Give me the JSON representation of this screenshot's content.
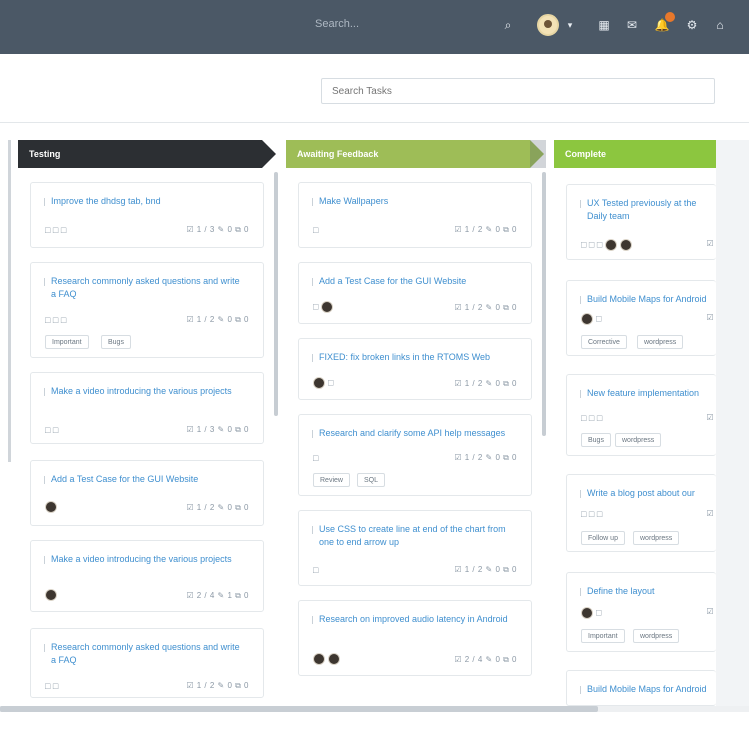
{
  "topbar": {
    "search_placeholder": "Search...",
    "icons": [
      "search-icon",
      "avatar",
      "caret-down-icon",
      "grid-icon",
      "chat-icon",
      "bell-icon",
      "gear-icon",
      "home-icon"
    ]
  },
  "toolbar": {
    "task_search_placeholder": "Search Tasks"
  },
  "colors": {
    "testing": "#2c2f33",
    "feedback": "#9ebd57",
    "complete": "#8cc63f",
    "link": "#3f8fcf",
    "topbar": "#4b5866"
  },
  "columns": [
    {
      "title": "Testing",
      "cards": [
        {
          "title": "Improve the dhdsg tab, bnd",
          "meta": "☑ 1 / 3  ✎ 0  ⧉ 0",
          "checks": "□ □ □",
          "tags": []
        },
        {
          "title": "Research commonly asked questions and write a FAQ",
          "meta": "☑ 1 / 2  ✎ 0  ⧉ 0",
          "checks": "□ □ □",
          "tags": [
            "Important",
            "Bugs"
          ]
        },
        {
          "title": "Make a video introducing the various projects",
          "meta": "☑ 1 / 3  ✎ 0  ⧉ 0",
          "checks": "□ □",
          "tags": []
        },
        {
          "title": "Add a Test Case for the GUI Website",
          "meta": "☑ 1 / 2  ✎ 0  ⧉ 0",
          "checks": "●",
          "tags": []
        },
        {
          "title": "Make a video introducing the various projects",
          "meta": "☑ 2 / 4  ✎ 1  ⧉ 0",
          "checks": "●",
          "tags": []
        },
        {
          "title": "Research commonly asked questions and write a FAQ",
          "meta": "☑ 1 / 2  ✎ 0  ⧉ 0",
          "checks": "□ □",
          "tags": []
        }
      ]
    },
    {
      "title": "Awaiting Feedback",
      "cards": [
        {
          "title": "Make Wallpapers",
          "meta": "☑ 1 / 2  ✎ 0  ⧉ 0",
          "checks": "□",
          "tags": []
        },
        {
          "title": "Add a Test Case for the GUI Website",
          "meta": "☑ 1 / 2  ✎ 0  ⧉ 0",
          "checks": "□ ●",
          "tags": []
        },
        {
          "title": "FIXED: fix broken links in the RTOMS Web",
          "meta": "☑ 1 / 2  ✎ 0  ⧉ 0",
          "checks": "● □",
          "tags": []
        },
        {
          "title": "Research and clarify some API help messages",
          "meta": "☑ 1 / 2  ✎ 0  ⧉ 0",
          "checks": "□",
          "tags": [
            "Review",
            "SQL"
          ]
        },
        {
          "title": "Use CSS to create line at end of the chart from one to end arrow up",
          "meta": "☑ 1 / 2  ✎ 0  ⧉ 0",
          "checks": "□",
          "tags": []
        },
        {
          "title": "Research on improved audio latency in Android",
          "meta": "☑ 2 / 4  ✎ 0  ⧉ 0",
          "checks": "● ●",
          "tags": []
        }
      ]
    },
    {
      "title": "Complete",
      "cards": [
        {
          "title": "UX Tested previously at the Daily team",
          "meta": "☑",
          "checks": "□ □ □ ● ●",
          "tags": []
        },
        {
          "title": "Build Mobile Maps for Android",
          "meta": "☑",
          "checks": "● □",
          "tags": [
            "Corrective",
            "wordpress"
          ]
        },
        {
          "title": "New feature implementation",
          "meta": "☑",
          "checks": "□ □ □",
          "tags": [
            "Bugs",
            "wordpress"
          ]
        },
        {
          "title": "Write a blog post about our",
          "meta": "☑",
          "checks": "□ □ □",
          "tags": [
            "Follow up",
            "wordpress"
          ]
        },
        {
          "title": "Define the layout",
          "meta": "☑",
          "checks": "● □",
          "tags": [
            "Important",
            "wordpress"
          ]
        },
        {
          "title": "Build Mobile Maps for Android",
          "meta": "",
          "checks": "",
          "tags": []
        }
      ]
    }
  ]
}
